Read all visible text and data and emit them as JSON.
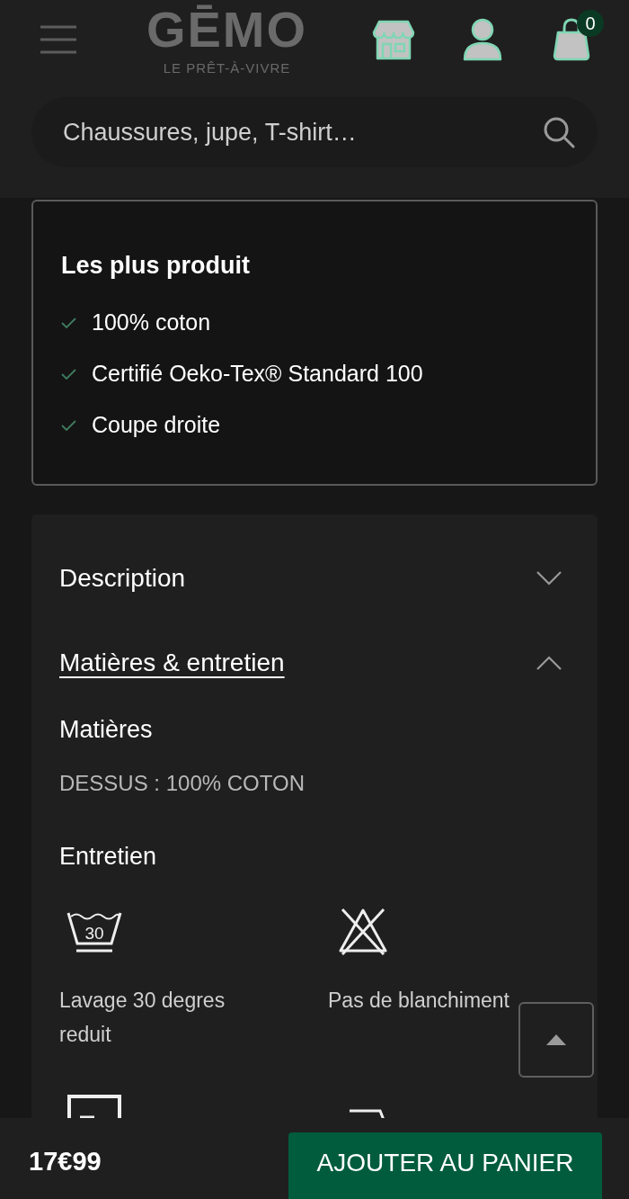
{
  "header": {
    "logo": "GĒMO",
    "tagline": "LE PRÊT-À-VIVRE",
    "cart_count": "0"
  },
  "search": {
    "placeholder": "Chaussures, jupe, T-shirt…"
  },
  "highlights": {
    "title": "Les plus produit",
    "items": [
      "100% coton",
      "Certifié Oeko-Tex® Standard 100",
      "Coupe droite"
    ]
  },
  "accordion": [
    {
      "title": "Description",
      "expanded": false
    },
    {
      "title": "Matières & entretien",
      "expanded": true,
      "content": {
        "materials_heading": "Matières",
        "materials_text": "DESSUS : 100% COTON",
        "care_heading": "Entretien",
        "care": [
          {
            "kind": "wash",
            "symbol_text": "30",
            "label": "Lavage 30 degres reduit"
          },
          {
            "kind": "no_bleach",
            "label": "Pas de blanchiment"
          },
          {
            "kind": "square"
          },
          {
            "kind": "corner"
          }
        ]
      }
    }
  ],
  "footer": {
    "price": "17€99",
    "add_to_cart": "AJOUTER AU PANIER"
  }
}
